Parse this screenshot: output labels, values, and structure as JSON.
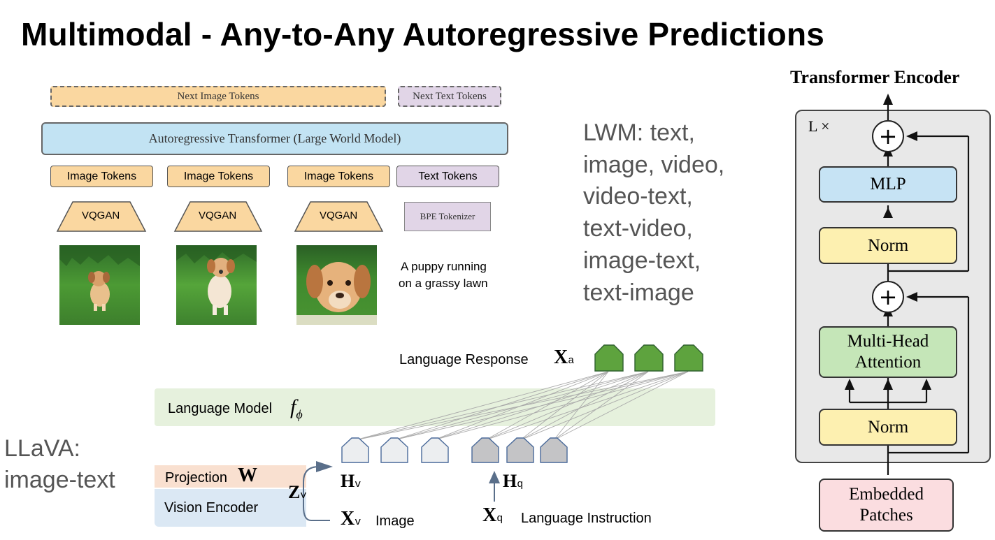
{
  "title": "Multimodal - Any-to-Any Autoregressive Predictions",
  "lwm": {
    "next_image_tokens": "Next Image Tokens",
    "next_text_tokens": "Next Text Tokens",
    "transformer": "Autoregressive Transformer (Large World Model)",
    "image_tokens": [
      "Image Tokens",
      "Image Tokens",
      "Image Tokens"
    ],
    "text_tokens": "Text Tokens",
    "vqgan": [
      "VQGAN",
      "VQGAN",
      "VQGAN"
    ],
    "bpe": "BPE Tokenizer",
    "caption_line1": "A puppy running",
    "caption_line2": "on a grassy lawn",
    "modalities": [
      "LWM: text,",
      "image, video,",
      "video-text,",
      "text-video,",
      "image-text,",
      "text-image"
    ]
  },
  "llava": {
    "label_line1": "LLaVA:",
    "label_line2": "image-text",
    "language_response": "Language Response",
    "xa": "X",
    "xa_sub": "a",
    "language_model": "Language Model",
    "f_phi": "f",
    "f_phi_sub": "ϕ",
    "projection": "Projection",
    "w": "W",
    "vision_encoder": "Vision Encoder",
    "zv": "Z",
    "zv_sub": "v",
    "hv": "H",
    "hv_sub": "v",
    "hq": "H",
    "hq_sub": "q",
    "xv": "X",
    "xv_sub": "v",
    "image": "Image",
    "xq": "X",
    "xq_sub": "q",
    "language_instruction": "Language Instruction"
  },
  "encoder": {
    "title": "Transformer Encoder",
    "repeat": "L ×",
    "mlp": "MLP",
    "norm_top": "Norm",
    "plus": "+",
    "mha_line1": "Multi-Head",
    "mha_line2": "Attention",
    "norm_bottom": "Norm",
    "embedded_line1": "Embedded",
    "embedded_line2": "Patches"
  }
}
